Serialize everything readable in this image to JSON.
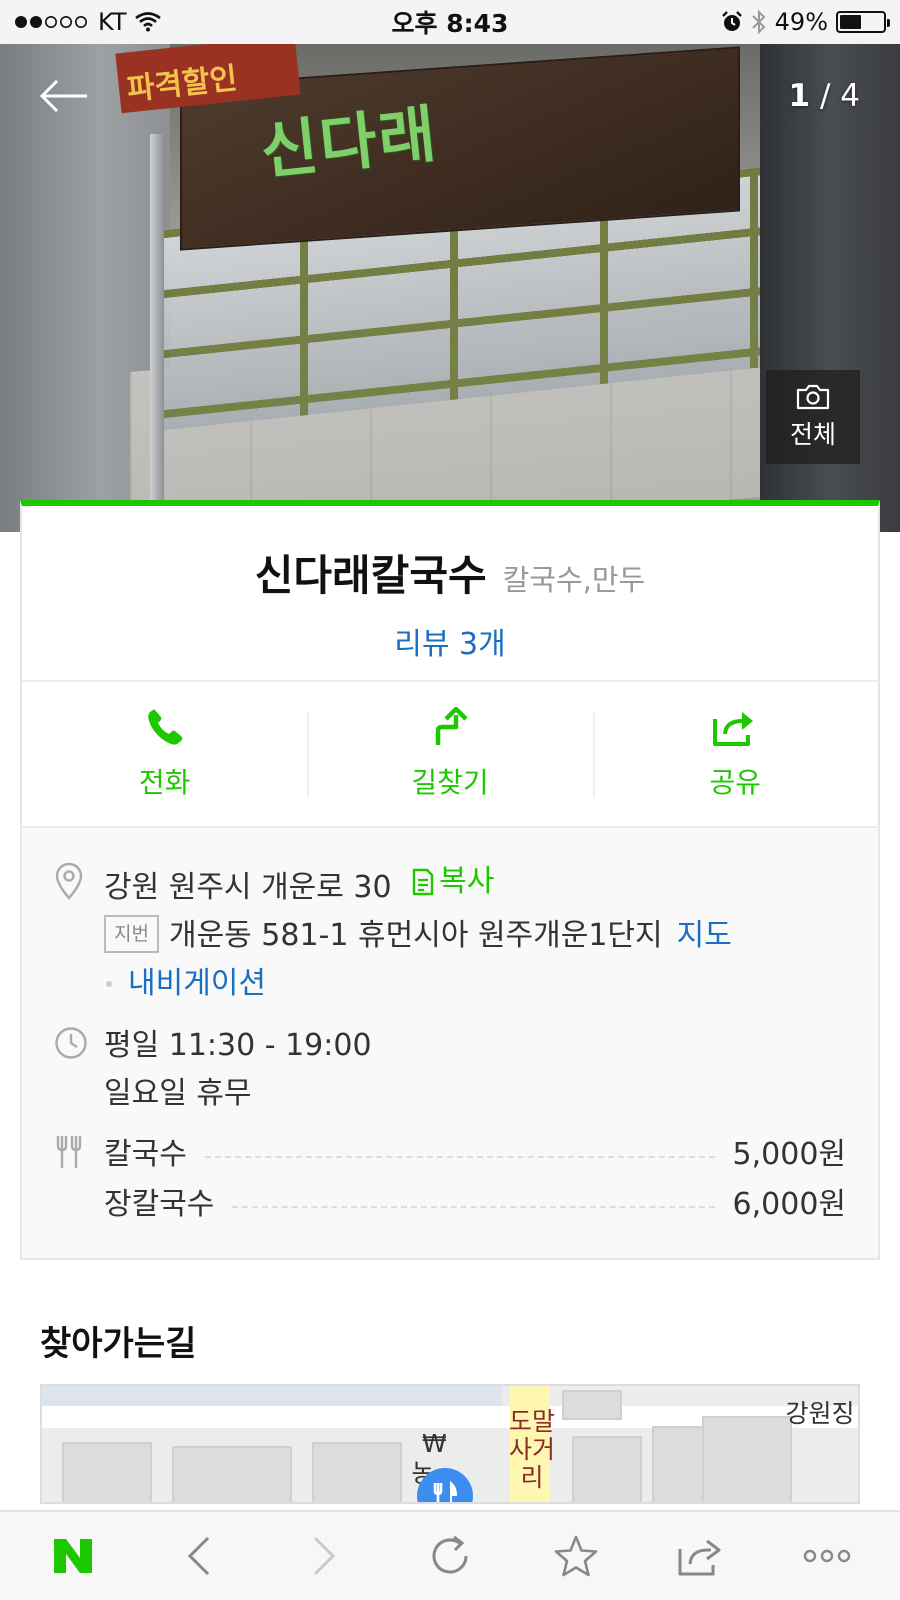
{
  "status_bar": {
    "carrier": "KT",
    "time": "오후 8:43",
    "battery": "49%",
    "battery_level": 0.49
  },
  "gallery": {
    "current": "1",
    "total": "/ 4",
    "all_photos_label": "전체",
    "photo_sign_text": "신다래",
    "photo_banner_text": "파격할인"
  },
  "place": {
    "name": "신다래칼국수",
    "category": "칼국수,만두",
    "reviews": "리뷰 3개"
  },
  "actions": [
    {
      "label": "전화",
      "icon": "phone-icon"
    },
    {
      "label": "길찾기",
      "icon": "directions-icon"
    },
    {
      "label": "공유",
      "icon": "share-icon"
    }
  ],
  "details": {
    "address": "강원 원주시 개운로 30",
    "copy_label": "복사",
    "jibun_badge": "지번",
    "jibun_address": "개운동 581-1 휴먼시아 원주개운1단지",
    "map_label": "지도",
    "navigation_label": "내비게이션",
    "hours_weekday": "평일 11:30 - 19:00",
    "hours_closed": "일요일 휴무",
    "menu": [
      {
        "name": "칼국수",
        "price": "5,000원"
      },
      {
        "name": "장칼국수",
        "price": "6,000원"
      }
    ]
  },
  "directions_section": {
    "title": "찾아가는길",
    "map_labels": {
      "crossing_line1": "도말",
      "crossing_line2": "사거리",
      "right_top": "강원징",
      "bank_symbol": "₩",
      "bank_partial": "농"
    }
  },
  "colors": {
    "accent_green": "#1ec800",
    "link_blue": "#1a6fc2"
  }
}
